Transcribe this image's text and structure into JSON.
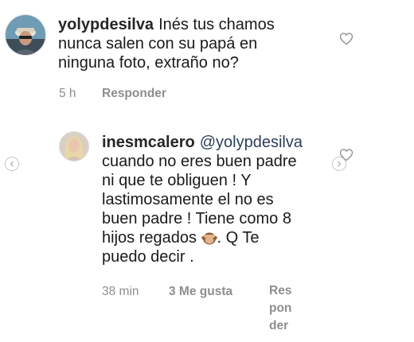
{
  "comments": [
    {
      "username": "yolypdesilva",
      "text": "Inés tus chamos nunca salen con su papá en ninguna foto, extraño no?",
      "line1": "Inés tus chamos",
      "line2": "nunca salen con su papá en",
      "line3": "ninguna foto, extraño no?",
      "time": "5 h",
      "reply_label": "Responder"
    }
  ],
  "reply": {
    "username": "inesmcalero",
    "mention": "@yolypdesilva",
    "lines": [
      "cuando no eres buen padre",
      "ni que te obliguen ! Y",
      "lastimosamente el no es",
      "buen padre ! Tiene como 8",
      "hijos regados",
      ". Q Te",
      "puedo decir ."
    ],
    "time": "38 min",
    "likes": "3 Me gusta",
    "reply_lines": [
      "Res",
      "pon",
      "der"
    ]
  },
  "icons": {
    "like": "heart-icon",
    "prev": "chevron-left-icon",
    "next": "chevron-right-icon",
    "emoji": "see-no-evil-monkey-emoji"
  },
  "colors": {
    "text": "#262626",
    "meta": "#8e8e8e",
    "heart_stroke": "#8e8e8e"
  }
}
